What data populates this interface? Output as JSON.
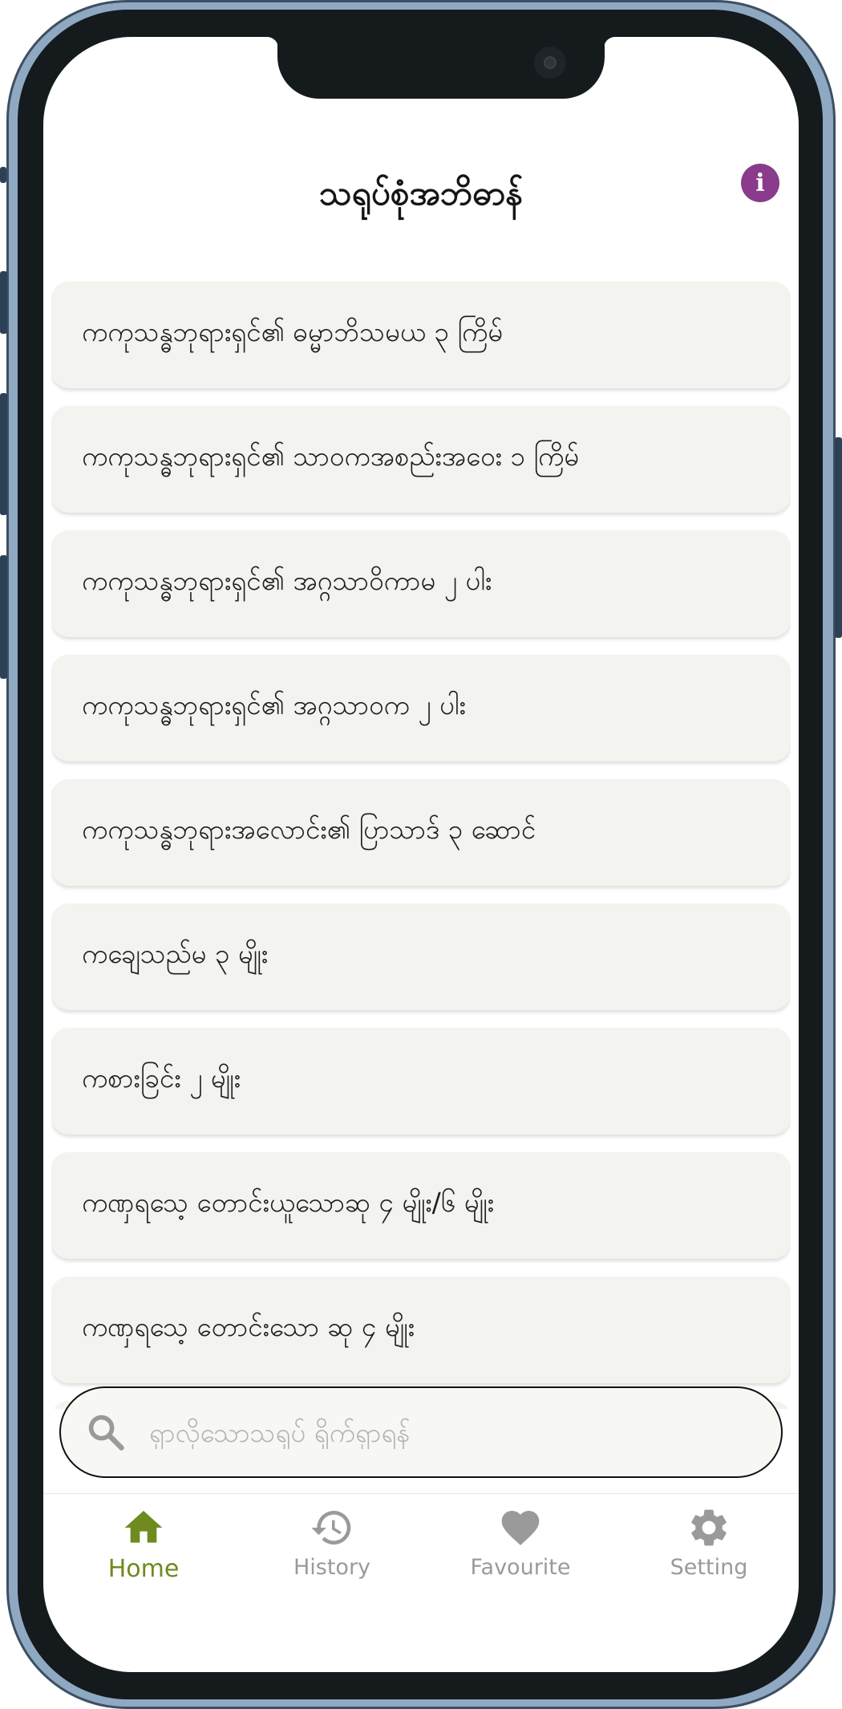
{
  "header": {
    "title": "သရုပ်စုံအဘိဓာန်",
    "info_icon": "info-icon",
    "info_symbol": "i",
    "info_color": "#8a3b8c"
  },
  "entries": [
    {
      "label": "ကကုသန္ဓဘုရားရှင်၏ ဓမ္မာဘိသမယ ၃ ကြိမ်"
    },
    {
      "label": "ကကုသန္ဓဘုရားရှင်၏ သာဝကအစည်းအဝေး ၁ ကြိမ်"
    },
    {
      "label": "ကကုသန္ဓဘုရားရှင်၏ အဂ္ဂသာဝိကာမ ၂ ပါး"
    },
    {
      "label": "ကကုသန္ဓဘုရားရှင်၏ အဂ္ဂသာဝက ၂ ပါး"
    },
    {
      "label": "ကကုသန္ဓဘုရားအလောင်း၏ ပြာသာဒ် ၃ ဆောင်"
    },
    {
      "label": "ကချေသည်မ ၃ မျိုး"
    },
    {
      "label": "ကစားခြင်း ၂ မျိုး"
    },
    {
      "label": "ကဏှရသေ့ တောင်းယူသောဆု ၄ မျိုး/၆ မျိုး"
    },
    {
      "label": "ကဏှရသေ့ တောင်းသော ဆု ၄ မျိုး"
    }
  ],
  "search": {
    "placeholder": "ရှာလိုသောသရုပ် ရိုက်ရှာရန်",
    "icon": "search-icon"
  },
  "nav": {
    "active_color": "#6f8a1f",
    "inactive_color": "#9a9a9a",
    "items": [
      {
        "label": "Home",
        "icon": "home-icon"
      },
      {
        "label": "History",
        "icon": "history-icon"
      },
      {
        "label": "Favourite",
        "icon": "heart-icon"
      },
      {
        "label": "Setting",
        "icon": "gear-icon"
      }
    ]
  }
}
